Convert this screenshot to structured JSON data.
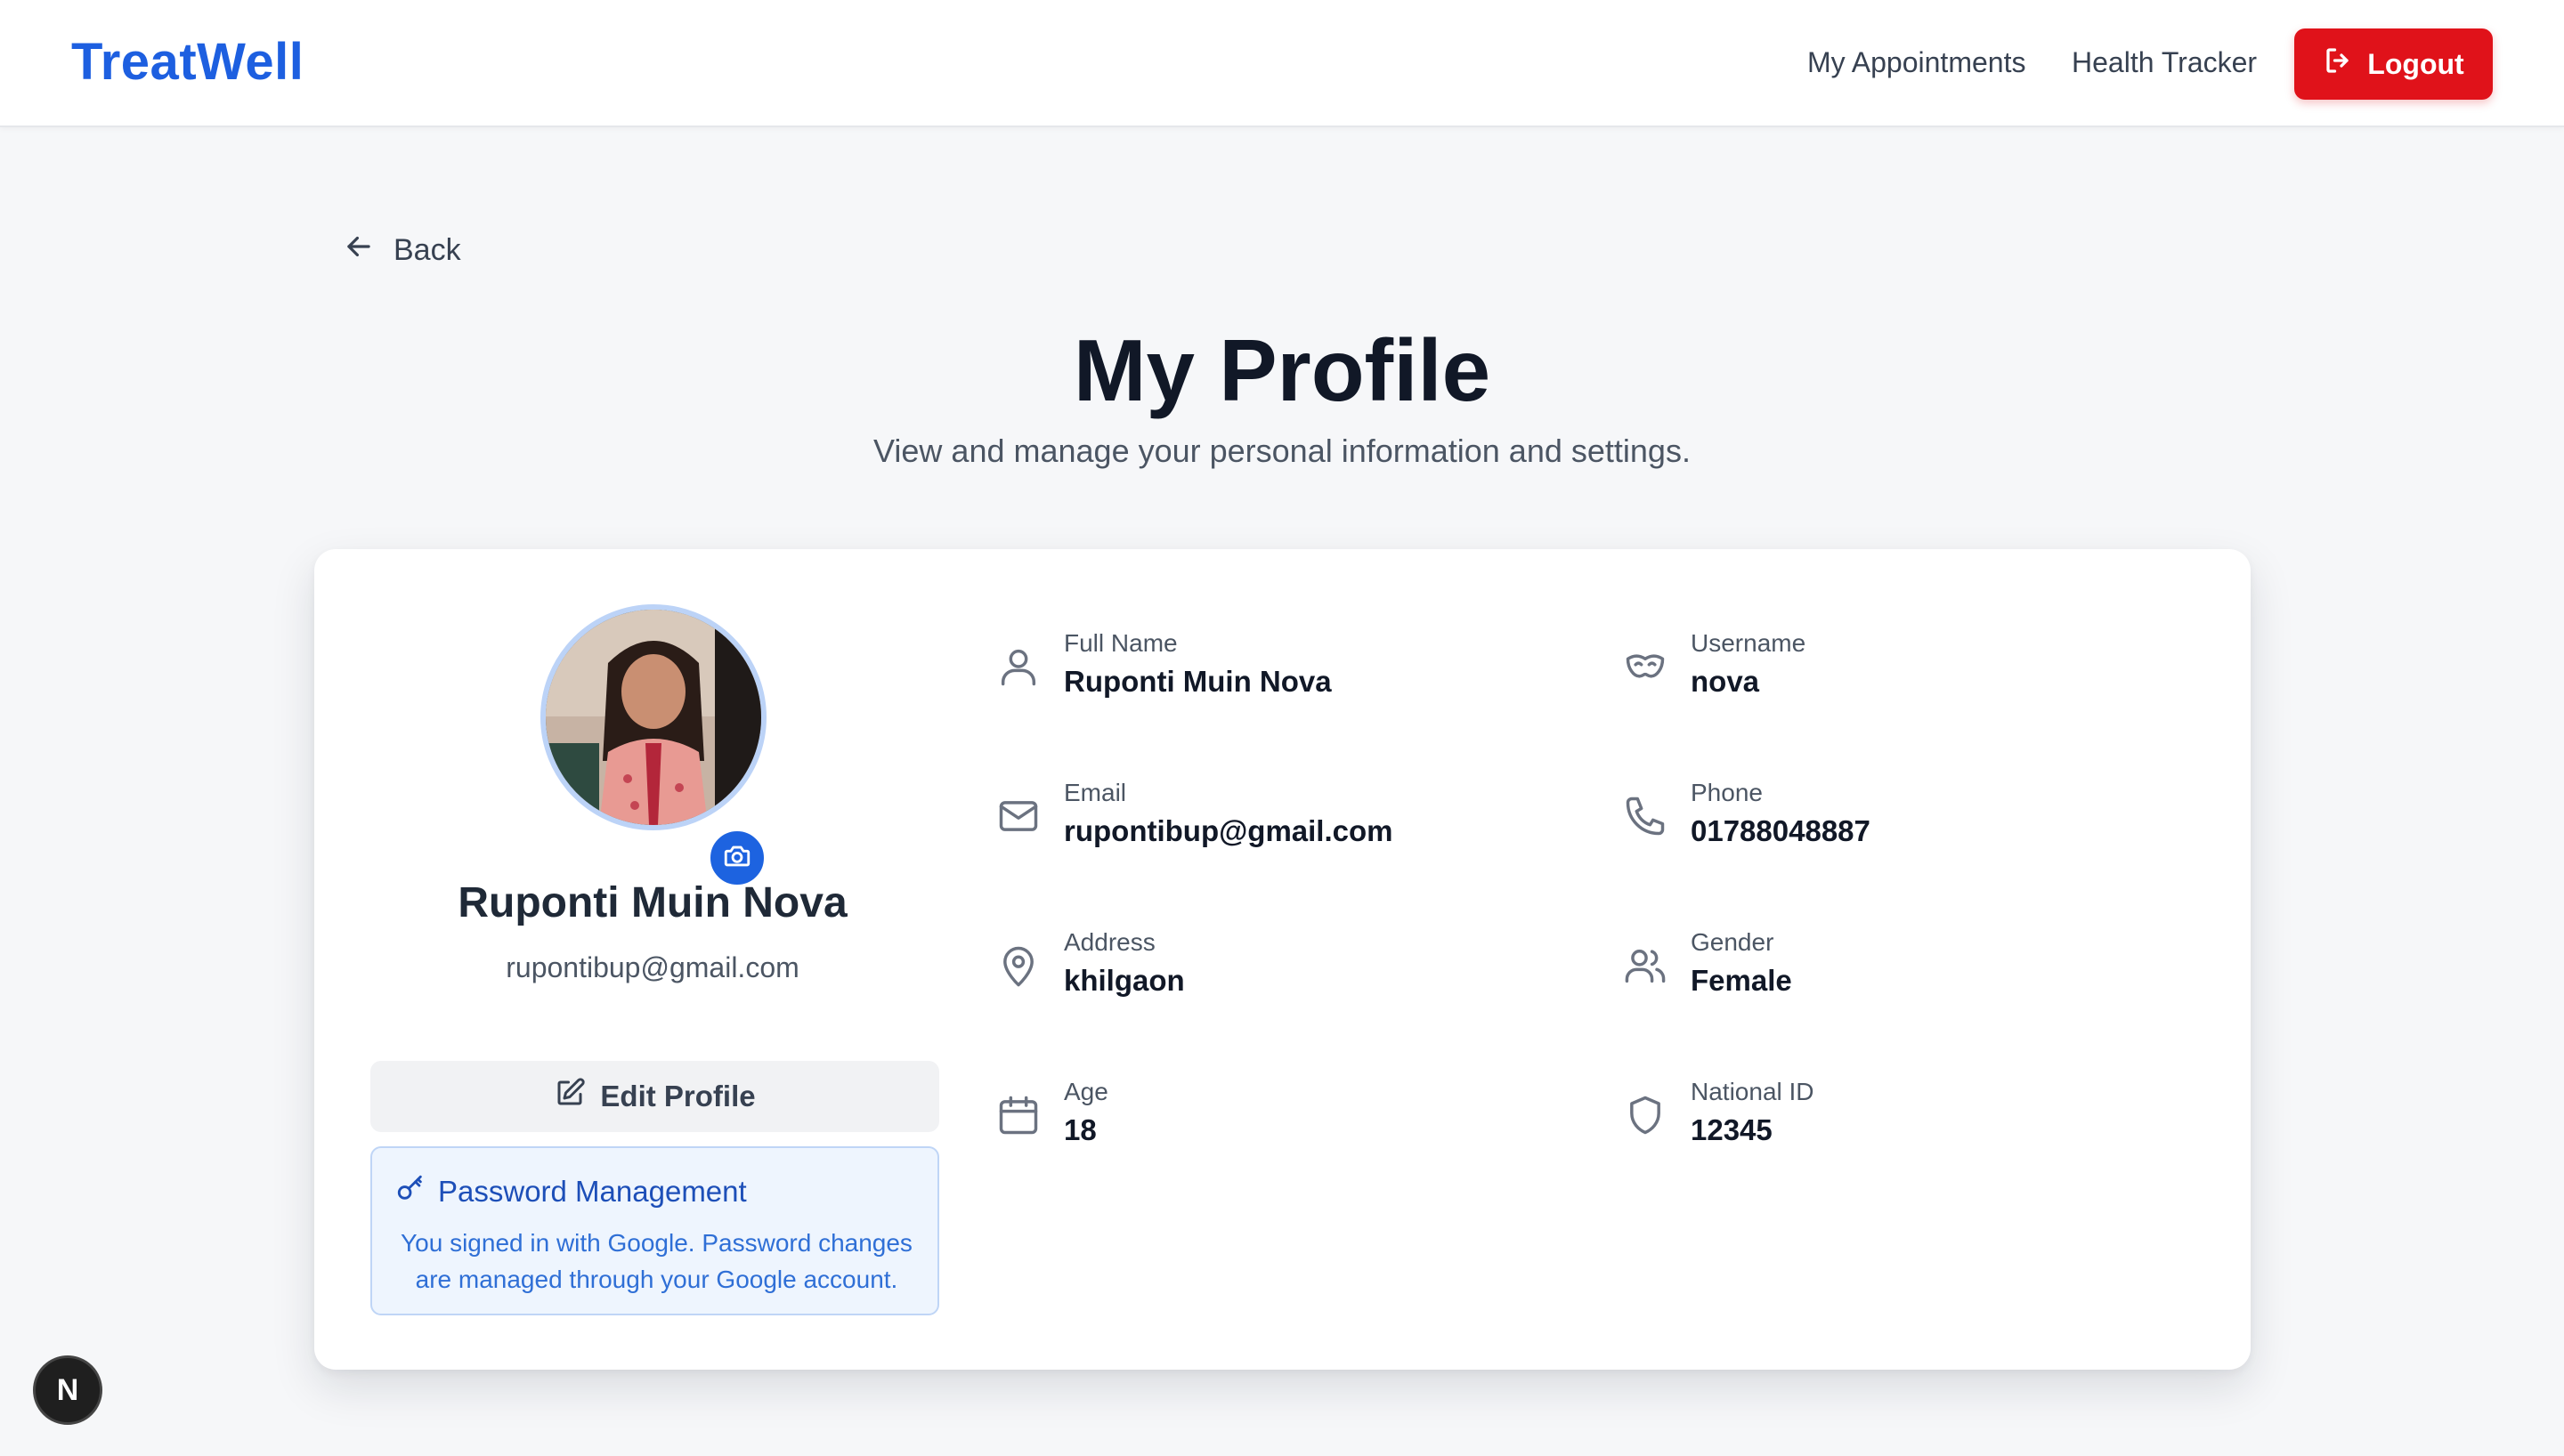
{
  "nav": {
    "brand": "TreatWell",
    "links": [
      "My Appointments",
      "Health Tracker"
    ],
    "logout_label": "Logout"
  },
  "back_label": "Back",
  "page": {
    "title": "My Profile",
    "subtitle": "View and manage your personal information and settings."
  },
  "profile": {
    "name": "Ruponti Muin Nova",
    "email": "rupontibup@gmail.com",
    "edit_label": "Edit Profile",
    "password": {
      "title": "Password Management",
      "text": "You signed in with Google. Password changes are managed through your Google account."
    }
  },
  "fields": [
    {
      "icon": "user-icon",
      "label": "Full Name",
      "value": "Ruponti Muin Nova"
    },
    {
      "icon": "mask-icon",
      "label": "Username",
      "value": "nova"
    },
    {
      "icon": "mail-icon",
      "label": "Email",
      "value": "rupontibup@gmail.com"
    },
    {
      "icon": "phone-icon",
      "label": "Phone",
      "value": "01788048887"
    },
    {
      "icon": "map-pin-icon",
      "label": "Address",
      "value": "khilgaon"
    },
    {
      "icon": "users-icon",
      "label": "Gender",
      "value": "Female"
    },
    {
      "icon": "calendar-icon",
      "label": "Age",
      "value": "18"
    },
    {
      "icon": "shield-icon",
      "label": "National ID",
      "value": "12345"
    }
  ],
  "dev_badge": "N",
  "colors": {
    "brand": "#1d5fe0",
    "logout": "#e0121a",
    "accent_blue": "#1d63e0"
  }
}
